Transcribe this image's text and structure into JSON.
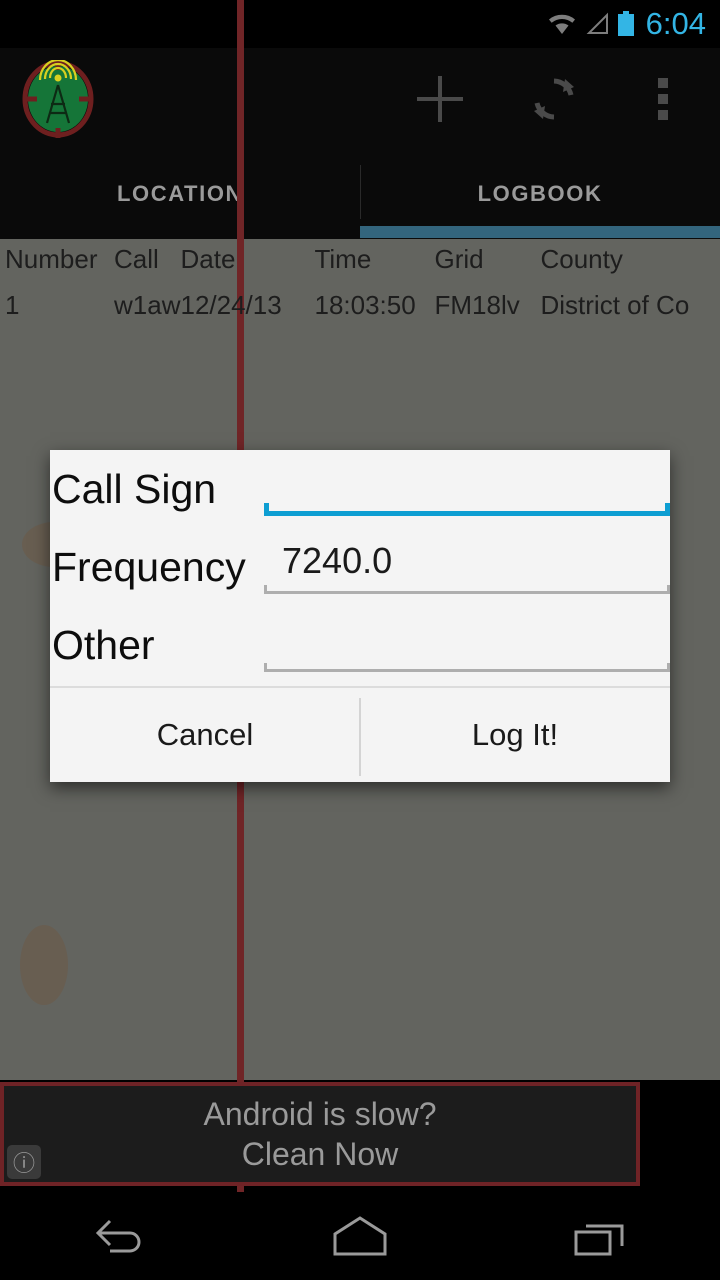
{
  "status_bar": {
    "time": "6:04",
    "icons": [
      "wifi-icon",
      "cell-signal-icon",
      "battery-icon"
    ],
    "accent_color": "#33b5e5"
  },
  "action_bar": {
    "app_icon": "radio-tower-icon",
    "actions": [
      {
        "name": "add-icon",
        "label": "Add"
      },
      {
        "name": "refresh-icon",
        "label": "Refresh"
      },
      {
        "name": "overflow-icon",
        "label": "More options"
      }
    ]
  },
  "tabs": {
    "items": [
      {
        "label": "LOCATION",
        "selected": false
      },
      {
        "label": "LOGBOOK",
        "selected": true
      }
    ],
    "indicator_color": "#33657d"
  },
  "logbook": {
    "headers": [
      "Number",
      "Call",
      "Date",
      "Time",
      "Grid",
      "County"
    ],
    "rows": [
      {
        "number": "1",
        "call": "w1aw",
        "date": "12/24/13",
        "time": "18:03:50",
        "grid": "FM18lv",
        "county": "District of Co"
      }
    ]
  },
  "dialog": {
    "fields": [
      {
        "label": "Call Sign",
        "value": "",
        "focused": true
      },
      {
        "label": "Frequency",
        "value": "7240.0",
        "focused": false
      },
      {
        "label": "Other",
        "value": "",
        "focused": false
      }
    ],
    "cancel_label": "Cancel",
    "confirm_label": "Log It!",
    "focus_color": "#0d9ed2"
  },
  "ad": {
    "line1": "Android is slow?",
    "line2": "Clean Now",
    "info_glyph": "ⓘ",
    "border_color": "#6f2326"
  },
  "nav_bar": {
    "buttons": [
      {
        "name": "back-icon",
        "label": "Back"
      },
      {
        "name": "home-icon",
        "label": "Home"
      },
      {
        "name": "recents-icon",
        "label": "Recent apps"
      }
    ]
  }
}
